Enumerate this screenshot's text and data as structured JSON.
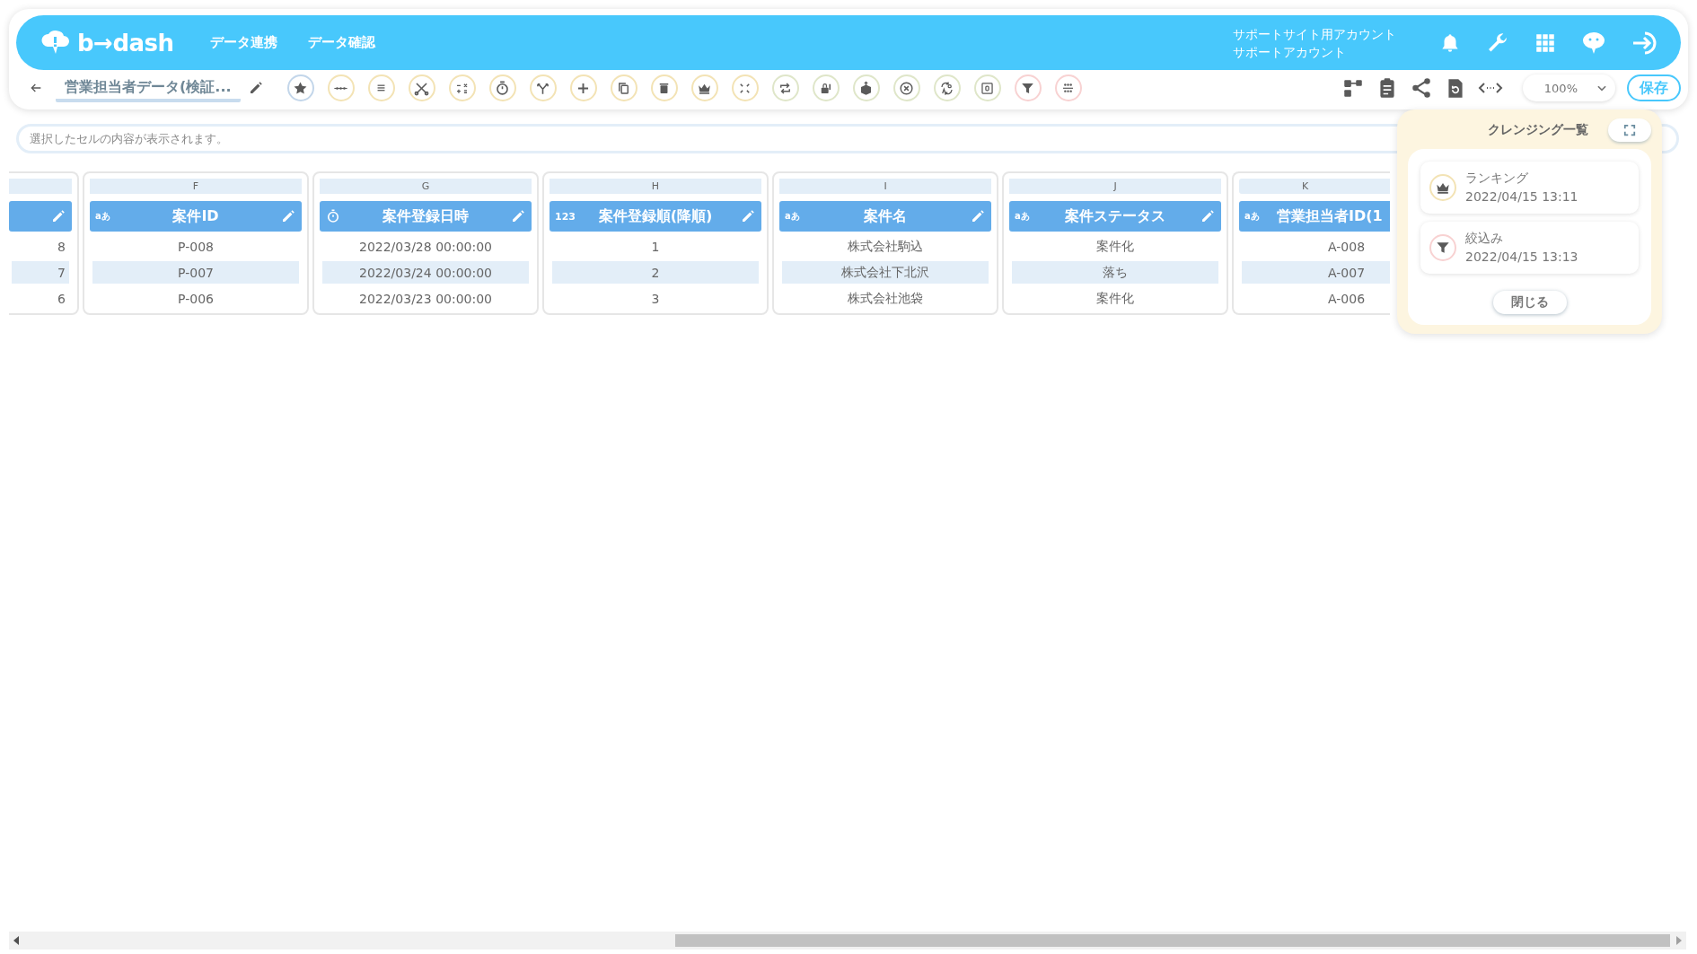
{
  "header": {
    "logo": "b→dash",
    "nav": [
      {
        "label": "データ連携"
      },
      {
        "label": "データ確認"
      }
    ],
    "account": {
      "site": "サポートサイト用アカウント",
      "user": "サポートアカウント"
    }
  },
  "toolbar": {
    "title": "営業担当者データ(検証...",
    "tools": [
      {
        "kind": "star",
        "color": "#c3d6ea"
      },
      {
        "kind": "dots",
        "color": "#f3e3b5"
      },
      {
        "kind": "list",
        "color": "#f3e3b5"
      },
      {
        "kind": "scissors",
        "color": "#f3e3b5"
      },
      {
        "kind": "calc",
        "color": "#f3e3b5"
      },
      {
        "kind": "timer",
        "color": "#f3e3b5"
      },
      {
        "kind": "fork",
        "color": "#f3e3b5"
      },
      {
        "kind": "plus",
        "color": "#f3e3b5"
      },
      {
        "kind": "copy",
        "color": "#f3e3b5"
      },
      {
        "kind": "trash",
        "color": "#f3e3b5"
      },
      {
        "kind": "crown",
        "color": "#f3e3b5"
      },
      {
        "kind": "compress",
        "color": "#f3e3b5"
      },
      {
        "kind": "repeat",
        "color": "#dfe6c9"
      },
      {
        "kind": "lock",
        "color": "#dfe6c9"
      },
      {
        "kind": "upload",
        "color": "#dfe6c9"
      },
      {
        "kind": "cancel",
        "color": "#dfe6c9"
      },
      {
        "kind": "swap",
        "color": "#dfe6c9"
      },
      {
        "kind": "frame",
        "color": "#dfe6c9"
      },
      {
        "kind": "filter",
        "color": "#f8d2d2"
      },
      {
        "kind": "group",
        "color": "#f8d2d2"
      }
    ],
    "zoom": "100%",
    "save": "保存"
  },
  "cell_bar": {
    "placeholder": "選択したセルの内容が表示されます。"
  },
  "columns": [
    {
      "values": [
        "8",
        "7",
        "6"
      ]
    },
    {
      "letter": "F",
      "kind": "text",
      "type_badge": "aあ",
      "title": "案件ID",
      "values": [
        "P-008",
        "P-007",
        "P-006"
      ]
    },
    {
      "letter": "G",
      "kind": "datetime",
      "title": "案件登録日時",
      "values": [
        "2022/03/28 00:00:00",
        "2022/03/24 00:00:00",
        "2022/03/23 00:00:00"
      ]
    },
    {
      "letter": "H",
      "kind": "number",
      "type_badge": "123",
      "title": "案件登録順(降順)",
      "values": [
        "1",
        "2",
        "3"
      ]
    },
    {
      "letter": "I",
      "kind": "text",
      "type_badge": "aあ",
      "title": "案件名",
      "values": [
        "株式会社駒込",
        "株式会社下北沢",
        "株式会社池袋"
      ]
    },
    {
      "letter": "J",
      "kind": "text",
      "type_badge": "aあ",
      "title": "案件ステータス",
      "values": [
        "案件化",
        "落ち",
        "案件化"
      ]
    },
    {
      "letter": "K",
      "kind": "text",
      "type_badge": "aあ",
      "title": "営業担当者ID(1",
      "values": [
        "A-008",
        "A-007",
        "A-006"
      ]
    }
  ],
  "cleansing_panel": {
    "title": "クレンジング一覧",
    "items": [
      {
        "kind": "crown",
        "color": "#f3e3b5",
        "name": "ランキング",
        "time": "2022/04/15 13:11"
      },
      {
        "kind": "filter",
        "color": "#f8d2d2",
        "name": "絞込み",
        "time": "2022/04/15 13:13"
      }
    ],
    "close": "閉じる"
  }
}
